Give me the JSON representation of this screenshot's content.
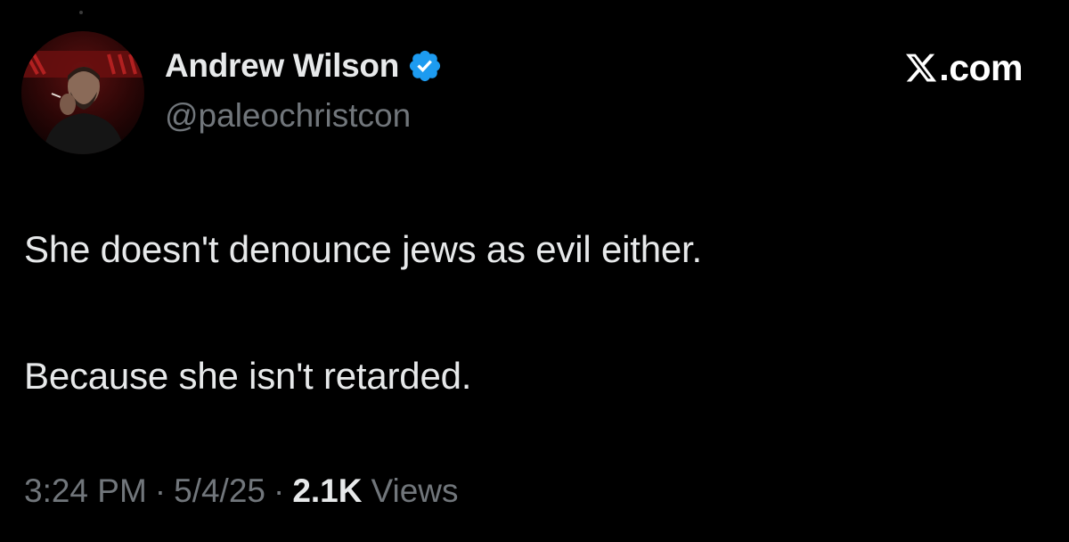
{
  "tweet": {
    "author": {
      "display_name": "Andrew Wilson",
      "handle": "@paleochristcon",
      "verified": true,
      "verified_badge_color": "#1d9bf0"
    },
    "brand": {
      "icon": "x-logo-icon",
      "text": ".com"
    },
    "body": {
      "line_1": "She doesn't denounce jews as evil either.",
      "line_2": "Because she isn't retarded."
    },
    "meta": {
      "time": "3:24 PM",
      "separator": "·",
      "date": "5/4/25",
      "views_count": "2.1K",
      "views_label": "Views"
    }
  },
  "colors": {
    "background": "#000000",
    "primary_text": "#e7e9ea",
    "secondary_text": "#71767b",
    "accent": "#1d9bf0"
  }
}
